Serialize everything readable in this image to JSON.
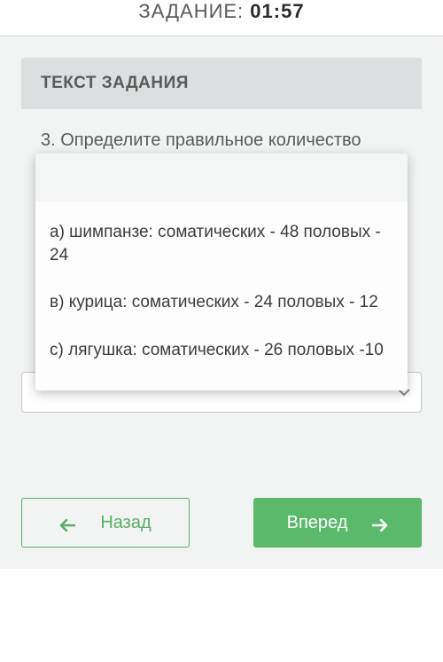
{
  "header": {
    "label": "ЗАДАНИЕ: ",
    "time": "01:57"
  },
  "panel": {
    "title": "ТЕКСТ ЗАДАНИЯ"
  },
  "question": {
    "text": "3. Определите правильное количество"
  },
  "options": {
    "a": "а) шимпанзе: соматических - 48 половых - 24",
    "b": "в) курица: соматических - 24 половых - 12",
    "c": "с) лягушка: соматических - 26 половых -10"
  },
  "nav": {
    "back": "Назад",
    "forward": "Вперед"
  }
}
